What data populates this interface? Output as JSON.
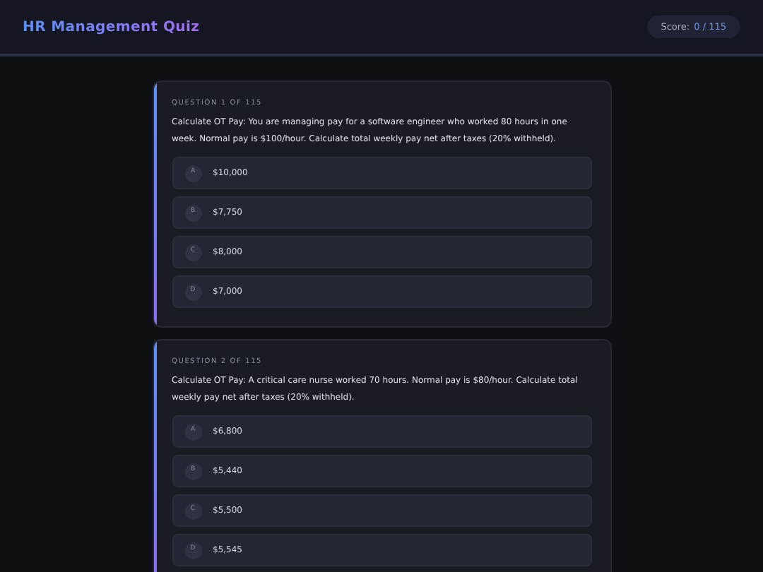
{
  "header": {
    "title": "HR Management Quiz",
    "score_label": "Score:",
    "score_value": "0 / 115"
  },
  "questions": [
    {
      "label": "QUESTION 1 OF 115",
      "text": "Calculate OT Pay: You are managing pay for a software engineer who worked 80 hours in one week. Normal pay is $100/hour. Calculate total weekly pay net after taxes (20% withheld).",
      "options": [
        {
          "letter": "A",
          "text": "$10,000"
        },
        {
          "letter": "B",
          "text": "$7,750"
        },
        {
          "letter": "C",
          "text": "$8,000"
        },
        {
          "letter": "D",
          "text": "$7,000"
        }
      ]
    },
    {
      "label": "QUESTION 2 OF 115",
      "text": "Calculate OT Pay: A critical care nurse worked 70 hours. Normal pay is $80/hour. Calculate total weekly pay net after taxes (20% withheld).",
      "options": [
        {
          "letter": "A",
          "text": "$6,800"
        },
        {
          "letter": "B",
          "text": "$5,440"
        },
        {
          "letter": "C",
          "text": "$5,500"
        },
        {
          "letter": "D",
          "text": "$5,545"
        }
      ]
    }
  ]
}
